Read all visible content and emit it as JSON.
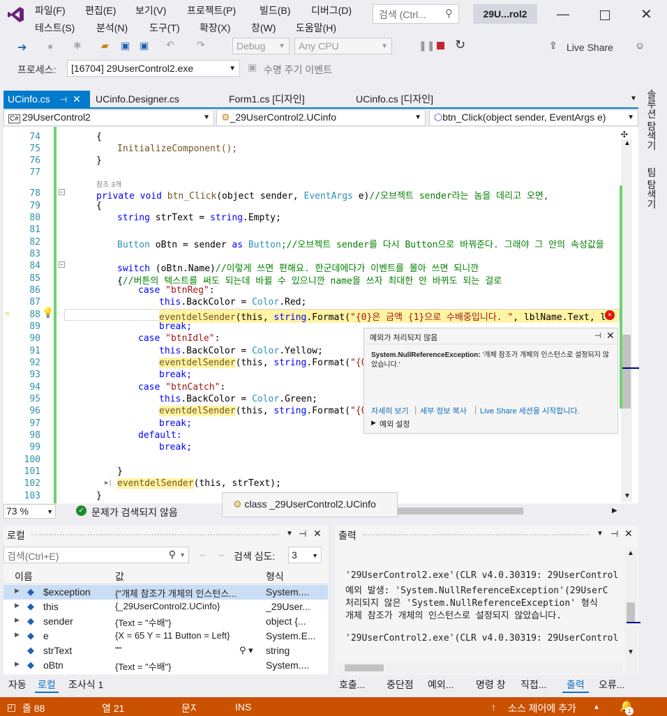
{
  "menu": {
    "row1": [
      "파일(F)",
      "편집(E)",
      "보기(V)",
      "프로젝트(P)",
      "빌드(B)",
      "디버그(D)"
    ],
    "row2": [
      "테스트(S)",
      "분석(N)",
      "도구(T)",
      "확장(X)",
      "창(W)",
      "도움말(H)"
    ],
    "search_placeholder": "검색 (Ctrl...",
    "window_title": "29U...rol2"
  },
  "toolbar": {
    "config": "Debug",
    "platform": "Any CPU",
    "live_share": "Live Share",
    "process_label": "프로세스:",
    "process_value": "[16704] 29UserControl2.exe",
    "lifecycle": "수명 주기 이벤트"
  },
  "tabs": [
    "UCinfo.cs",
    "UCinfo.Designer.cs",
    "Form1.cs [디자인]",
    "UCinfo.cs [디자인]"
  ],
  "navbar": {
    "project": "29UserControl2",
    "class": "_29UserControl2.UCinfo",
    "member": "btn_Click(object sender, EventArgs e)"
  },
  "editor": {
    "ref_count": "참조 3개",
    "line_numbers": [
      "74",
      "75",
      "76",
      "77",
      "78",
      "79",
      "80",
      "81",
      "82",
      "83",
      "84",
      "85",
      "86",
      "87",
      "88",
      "89",
      "90",
      "91",
      "92",
      "93",
      "94",
      "95",
      "96",
      "97",
      "98",
      "99",
      "100",
      "101",
      "102",
      "103"
    ],
    "zoom": "73 %",
    "issues": "문제가 검색되지 않음",
    "class_tip": "class _29UserControl2.UCinfo"
  },
  "code": {
    "l74": "{",
    "l75": "InitializeComponent();",
    "l76": "}",
    "l78a": "private void ",
    "l78b": "btn_Click",
    "l78c": "(object sender, ",
    "l78d": "EventArgs",
    "l78e": " e)",
    "l78f": "//오브젝트 sender라는 놈을 데리고 오면,",
    "l79": "{",
    "l80a": "string",
    "l80b": " strText = ",
    "l80c": "string",
    "l80d": ".Empty;",
    "l82a": "Button",
    "l82b": " oBtn = sender ",
    "l82c": "as",
    "l82d": " Button",
    "l82e": ";//오브젝트 sender를 다시 Button으로 바꿔준다. 그래야 그 안의 속성값을",
    "l84a": "switch",
    "l84b": " (oBtn.Name)",
    "l84c": "//이렇게 쓰면 편해요. 한군데에다가 이벤트를 몰아 쓰면 되니깐",
    "l85a": "{",
    "l85b": "//버튼의 텍스트를 써도 되는데 바뀔 수 있으니깐 name을 쓰자 최대한 안 바뀌도 되는 걸로",
    "l86a": "case",
    "l86b": "\"btnReg\"",
    "l87a": "this",
    "l87b": ".BackColor = ",
    "l87c": "Color",
    "l87d": ".Red;",
    "l88a": "eventdelSender",
    "l88b": "(this, ",
    "l88c": "string",
    "l88d": ".Format(",
    "l88e": "\"{0}은 금액 {1}으로 수배중입니다. \"",
    "l88f": ", lblName.Text, l",
    "l89": "break;",
    "l90a": "case",
    "l90b": "\"btnIdle\"",
    "l91a": "this",
    "l91b": ".BackColor = ",
    "l91c": "Color",
    "l91d": ".Yellow;",
    "l92a": "eventdelSender",
    "l92b": "(this, ",
    "l92c": "string",
    "l92d": ".Format(",
    "l92e": "\"{0}",
    "l93": "break;",
    "l94a": "case",
    "l94b": "\"btnCatch\"",
    "l95a": "this",
    "l95b": ".BackColor = ",
    "l95c": "Color",
    "l95d": ".Green;",
    "l96a": "eventdelSender",
    "l96b": "(this, ",
    "l96c": "string",
    "l96d": ".Format(",
    "l96e": "\"{0}",
    "l97": "break;",
    "l98": "default:",
    "l99": "break;",
    "l101": "}",
    "l102a": "eventdelSender",
    "l102b": "(this, strText);",
    "l103": "}"
  },
  "exception": {
    "title": "예외가 처리되지 않음",
    "type": "System.NullReferenceException:",
    "message": "'개체 참조가 개체의 인스턴스로 설정되지 않았습니다.'",
    "link1": "자세히 보기",
    "link2": "세부 정보 복사",
    "link3": "Live Share 세션을 시작합니다.",
    "settings": "예외 설정"
  },
  "locals": {
    "title": "로컬",
    "search_placeholder": "검색(Ctrl+E)",
    "depth_label": "검색 심도:",
    "depth_value": "3",
    "headers": [
      "이름",
      "값",
      "형식"
    ],
    "rows": [
      {
        "name": "$exception",
        "value": "{\"개체 참조가 개체의 인스턴스...",
        "type": "System...."
      },
      {
        "name": "this",
        "value": "{_29UserControl2.UCinfo}",
        "type": "_29User..."
      },
      {
        "name": "sender",
        "value": "{Text = \"수배\"}",
        "type": "object {..."
      },
      {
        "name": "e",
        "value": "{X = 65 Y = 11 Button = Left}",
        "type": "System.E..."
      },
      {
        "name": "strText",
        "value": "\"\"",
        "type": "string"
      },
      {
        "name": "oBtn",
        "value": "{Text = \"수배\"}",
        "type": "System...."
      }
    ],
    "tabs": [
      "자동",
      "로컬",
      "조사식 1"
    ]
  },
  "output": {
    "title": "출력",
    "lines": [
      "'29UserControl2.exe'(CLR v4.0.30319: 29UserControl",
      "예외 발생: 'System.NullReferenceException'(29UserC",
      "처리되지 않은 'System.NullReferenceException' 형식",
      "개체 참조가 개체의 인스턴스로 설정되지 않았습니다.",
      "",
      "'29UserControl2.exe'(CLR v4.0.30319: 29UserControl"
    ],
    "tabs": [
      "호출...",
      "중단점",
      "예외...",
      "명령 창",
      "직접...",
      "출력",
      "오류..."
    ]
  },
  "side_tabs": [
    "솔루션 탐색기",
    "팀 탐색기"
  ],
  "status": {
    "line": "줄 88",
    "col": "열 21",
    "char": "문자",
    "ins": "INS",
    "source_control": "소스 제어에 추가",
    "notif": "1"
  },
  "colors": {
    "accent": "#007acc",
    "status_bar": "#ca5100",
    "keyword": "#0000ff",
    "type": "#2b91af",
    "string": "#a31515",
    "comment": "#008000"
  }
}
